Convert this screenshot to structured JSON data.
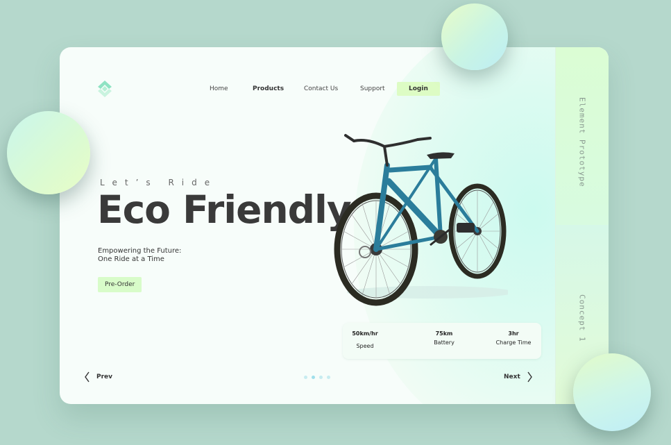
{
  "nav": {
    "items": [
      {
        "label": "Home"
      },
      {
        "label": "Products"
      },
      {
        "label": "Contact Us"
      },
      {
        "label": "Support"
      }
    ],
    "login_label": "Login"
  },
  "hero": {
    "tagline": "Let’s Ride",
    "headline": "Eco Friendly",
    "subtext_line1": "Empowering the Future:",
    "subtext_line2": "One Ride at a Time",
    "cta_label": "Pre-Order"
  },
  "stats": [
    {
      "value": "50km/hr",
      "label": "Speed"
    },
    {
      "value": "75km",
      "label": "Battery"
    },
    {
      "value": "3hr",
      "label": "Charge Time"
    }
  ],
  "pagination": {
    "prev_label": "Prev",
    "next_label": "Next",
    "dot_count": 4,
    "active_dot": 1
  },
  "side": {
    "top_label": "Element Prototype",
    "bottom_label": "Concept 1"
  },
  "colors": {
    "background": "#b5d8cc",
    "card": "#f7fdfa",
    "accent_green": "#ddfcc4",
    "headline": "#3a3a3a",
    "bike_frame": "#2b7d9b",
    "logo": "#8fe3c3"
  },
  "icons": {
    "logo": "diamond-logo-icon",
    "prev": "chevron-left-icon",
    "next": "chevron-right-icon"
  }
}
